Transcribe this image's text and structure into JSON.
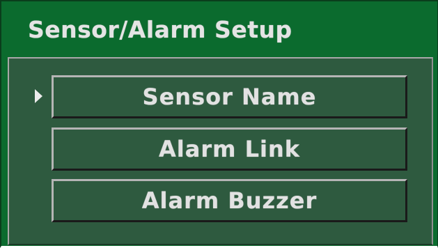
{
  "window": {
    "title": "Sensor/Alarm Setup"
  },
  "menu": {
    "selected_index": 0,
    "items": [
      {
        "label": "Sensor Name"
      },
      {
        "label": "Alarm Link"
      },
      {
        "label": "Alarm Buzzer"
      }
    ]
  },
  "icons": {
    "selector": "selection-arrow-icon"
  },
  "colors": {
    "window_background": "#0b6b2e",
    "panel_background": "#2e5a3f",
    "text": "#e2e2e2"
  }
}
